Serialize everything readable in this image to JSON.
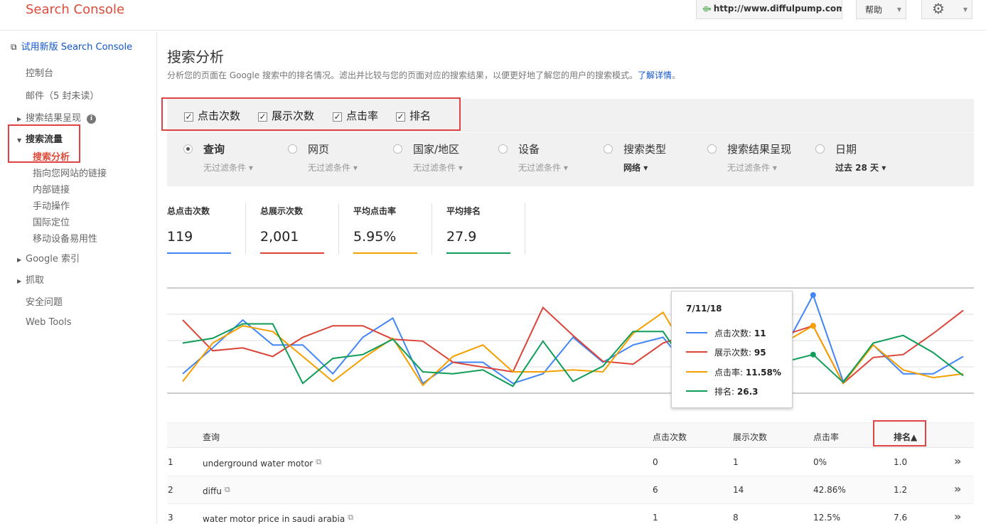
{
  "header": {
    "app_name": "Search Console",
    "site_url": "http://www.diffulpump.com/",
    "help_label": "帮助",
    "globe_icon": "globe-icon",
    "gear_icon": "gear-icon"
  },
  "sidebar": {
    "new_version": "试用新版 Search Console",
    "dashboard": "控制台",
    "messages": "邮件（5 封未读）",
    "search_appearance": "搜索结果呈现",
    "search_traffic": "搜索流量",
    "search_analytics": "搜索分析",
    "links_to_site": "指向您网站的链接",
    "internal_links": "内部链接",
    "manual_actions": "手动操作",
    "intl_targeting": "国际定位",
    "mobile_usability": "移动设备易用性",
    "google_index": "Google 索引",
    "crawl": "抓取",
    "security_issues": "安全问题",
    "web_tools": "Web Tools"
  },
  "main": {
    "title": "搜索分析",
    "description": "分析您的页面在 Google 搜索中的排名情况。滤出并比较与您的页面对应的搜索结果，以便更好地了解您的用户的搜索模式。",
    "learn_more": "了解详情",
    "end_period": "。"
  },
  "metrics": {
    "clicks": "点击次数",
    "impressions": "展示次数",
    "ctr": "点击率",
    "position": "排名"
  },
  "filters": [
    {
      "label": "查询",
      "sub": "无过滤条件",
      "selected": true
    },
    {
      "label": "网页",
      "sub": "无过滤条件",
      "selected": false
    },
    {
      "label": "国家/地区",
      "sub": "无过滤条件",
      "selected": false
    },
    {
      "label": "设备",
      "sub": "无过滤条件",
      "selected": false
    },
    {
      "label": "搜索类型",
      "sub": "网络",
      "selected": false
    },
    {
      "label": "搜索结果呈现",
      "sub": "无过滤条件",
      "selected": false
    },
    {
      "label": "日期",
      "sub": "过去 28 天",
      "selected": false
    }
  ],
  "totals": [
    {
      "label": "总点击次数",
      "value": "119",
      "color": "#4285f4"
    },
    {
      "label": "总展示次数",
      "value": "2,001",
      "color": "#db4437"
    },
    {
      "label": "平均点击率",
      "value": "5.95%",
      "color": "#f4a000"
    },
    {
      "label": "平均排名",
      "value": "27.9",
      "color": "#0f9d58"
    }
  ],
  "chart_data": {
    "type": "line",
    "series": [
      {
        "name": "点击次数",
        "color": "#4285f4",
        "values": [
          0.18,
          0.45,
          0.74,
          0.48,
          0.48,
          0.18,
          0.56,
          0.76,
          0.08,
          0.3,
          0.3,
          0.08,
          0.18,
          0.56,
          0.3,
          0.48,
          0.56,
          0.18,
          0.25,
          0.38,
          0.42,
          1.0,
          0.1,
          0.48,
          0.18,
          0.18,
          0.36
        ]
      },
      {
        "name": "展示次数",
        "color": "#db4437",
        "values": [
          0.74,
          0.42,
          0.45,
          0.36,
          0.56,
          0.68,
          0.68,
          0.54,
          0.52,
          0.3,
          0.25,
          0.2,
          0.87,
          0.58,
          0.31,
          0.28,
          0.5,
          0.6,
          0.2,
          0.28,
          0.58,
          0.68,
          0.08,
          0.35,
          0.38,
          0.6,
          0.84
        ]
      },
      {
        "name": "点击率",
        "color": "#f4a000",
        "values": [
          0.1,
          0.5,
          0.68,
          0.62,
          0.36,
          0.1,
          0.34,
          0.55,
          0.06,
          0.36,
          0.48,
          0.2,
          0.2,
          0.22,
          0.2,
          0.6,
          0.82,
          0.3,
          0.48,
          0.52,
          0.5,
          0.68,
          0.08,
          0.48,
          0.22,
          0.14,
          0.18
        ]
      },
      {
        "name": "排名",
        "color": "#0f9d58",
        "values": [
          0.5,
          0.55,
          0.7,
          0.7,
          0.08,
          0.34,
          0.38,
          0.54,
          0.2,
          0.18,
          0.22,
          0.05,
          0.52,
          0.1,
          0.26,
          0.62,
          0.62,
          0.16,
          0.28,
          0.34,
          0.3,
          0.38,
          0.09,
          0.5,
          0.58,
          0.4,
          0.16
        ]
      }
    ],
    "tooltip": {
      "date": "7/11/18",
      "rows": [
        {
          "name": "点击次数",
          "value": "11",
          "color": "#4285f4"
        },
        {
          "name": "展示次数",
          "value": "95",
          "color": "#db4437"
        },
        {
          "name": "点击率",
          "value": "11.58%",
          "color": "#f4a000"
        },
        {
          "name": "排名",
          "value": "26.3",
          "color": "#0f9d58"
        }
      ]
    }
  },
  "table": {
    "headers": [
      "查询",
      "点击次数",
      "展示次数",
      "点击率",
      "排名▲"
    ],
    "rows": [
      {
        "idx": "1",
        "query": "underground water motor",
        "clicks": "0",
        "impr": "1",
        "ctr": "0%",
        "pos": "1.0"
      },
      {
        "idx": "2",
        "query": "diffu",
        "clicks": "6",
        "impr": "14",
        "ctr": "42.86%",
        "pos": "1.2"
      },
      {
        "idx": "3",
        "query": "water motor price in saudi arabia",
        "clicks": "1",
        "impr": "8",
        "ctr": "12.5%",
        "pos": "7.6"
      }
    ],
    "more_icon": "double-chevron-right-icon"
  }
}
